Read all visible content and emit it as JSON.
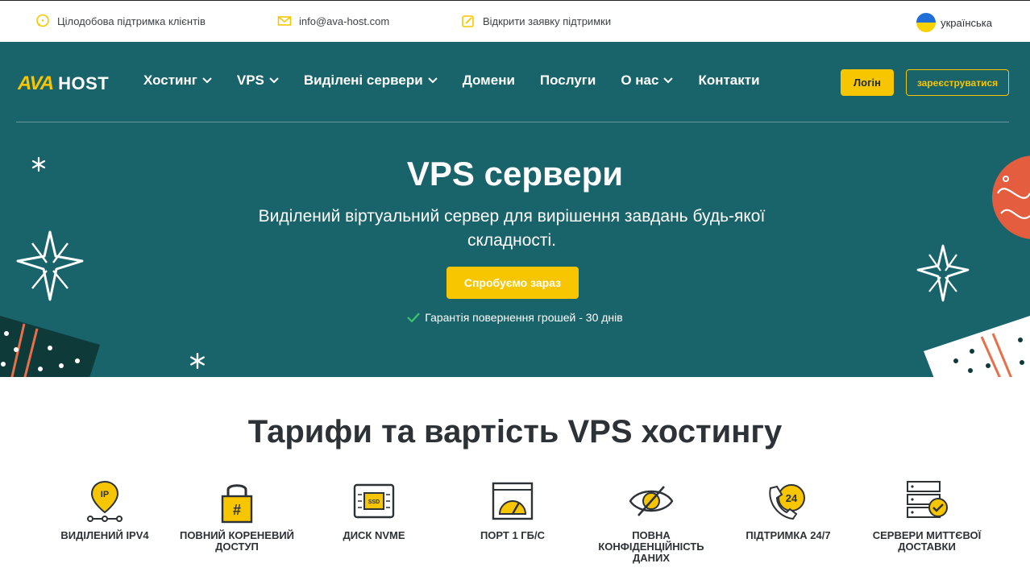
{
  "topbar": {
    "support": "Цілодобова підтримка клієнтів",
    "email": "info@ava-host.com",
    "ticket": "Відкрити заявку підтримки",
    "language": "українська"
  },
  "header": {
    "logo_ava": "AVA",
    "logo_host": "HOST",
    "nav": [
      {
        "label": "Хостинг",
        "dropdown": true
      },
      {
        "label": "VPS",
        "dropdown": true
      },
      {
        "label": "Виділені сервери",
        "dropdown": true
      },
      {
        "label": "Домени",
        "dropdown": false
      },
      {
        "label": "Послуги",
        "dropdown": false
      },
      {
        "label": "О нас",
        "dropdown": true
      },
      {
        "label": "Контакти",
        "dropdown": false
      }
    ],
    "login": "Логін",
    "register": "зареєструватися"
  },
  "hero": {
    "title": "VPS сервери",
    "subtitle": "Виділений віртуальний сервер для вирішення завдань будь-якої складності.",
    "cta": "Спробуємо зараз",
    "guarantee": "Гарантія повернення грошей - 30 днів"
  },
  "tariffs": {
    "title": "Тарифи та вартість VPS хостингу",
    "features": [
      {
        "label": "Виділений IPV4",
        "icon": "ip-pin-icon"
      },
      {
        "label": "Повний кореневий доступ",
        "icon": "lock-icon"
      },
      {
        "label": "Диск NVME",
        "icon": "ssd-icon"
      },
      {
        "label": "Порт 1 Гб/с",
        "icon": "speed-gauge-icon"
      },
      {
        "label": "Повна конфіденційність даних",
        "icon": "privacy-eye-icon"
      },
      {
        "label": "Підтримка 24/7",
        "icon": "support-24-icon"
      },
      {
        "label": "Сервери миттєвої доставки",
        "icon": "server-check-icon"
      }
    ]
  },
  "colors": {
    "hero_bg": "#19636a",
    "accent": "#f7c600",
    "text_dark": "#2d3236"
  }
}
